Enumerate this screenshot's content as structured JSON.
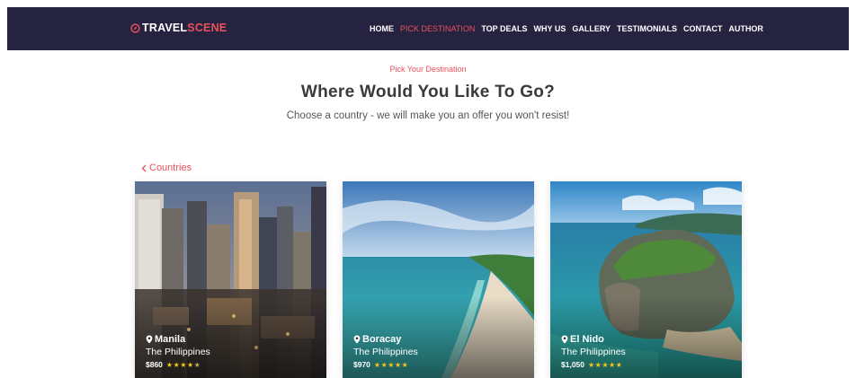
{
  "brand": {
    "prefix": "TRAVEL",
    "suffix": "SCENE"
  },
  "nav": [
    {
      "label": "HOME",
      "active": false
    },
    {
      "label": "PICK DESTINATION",
      "active": true
    },
    {
      "label": "TOP DEALS",
      "active": false
    },
    {
      "label": "WHY US",
      "active": false
    },
    {
      "label": "GALLERY",
      "active": false
    },
    {
      "label": "TESTIMONIALS",
      "active": false
    },
    {
      "label": "CONTACT",
      "active": false
    },
    {
      "label": "AUTHOR",
      "active": false
    }
  ],
  "section": {
    "eyebrow": "Pick Your Destination",
    "title": "Where Would You Like To Go?",
    "subtitle": "Choose a country - we will make you an offer you won't resist!",
    "back_label": "Countries"
  },
  "cards": [
    {
      "name": "Manila",
      "country": "The Philippines",
      "price": "$860",
      "rating": 4.5
    },
    {
      "name": "Boracay",
      "country": "The Philippines",
      "price": "$970",
      "rating": 5
    },
    {
      "name": "El Nido",
      "country": "The Philippines",
      "price": "$1,050",
      "rating": 5
    }
  ],
  "colors": {
    "navbar": "#262341",
    "accent": "#e8505b",
    "star": "#f5c518"
  },
  "icons": {
    "logo": "compass-icon",
    "back": "chevron-left-icon",
    "pin": "map-pin-icon",
    "star": "star-icon"
  }
}
